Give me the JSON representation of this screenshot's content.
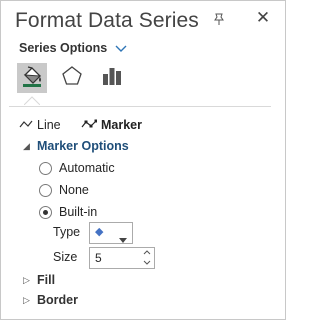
{
  "pane": {
    "title": "Format Data Series",
    "pin_icon": "pin-down-icon",
    "close_glyph": "✕"
  },
  "series_options": {
    "label": "Series Options"
  },
  "icon_tabs": [
    {
      "name": "fill-line-tab",
      "icon": "paint-bucket-icon",
      "selected": true
    },
    {
      "name": "effects-tab",
      "icon": "pentagon-icon",
      "selected": false
    },
    {
      "name": "series-options-tab",
      "icon": "bar-chart-icon",
      "selected": false
    }
  ],
  "subtabs": {
    "line_label": "Line",
    "marker_label": "Marker",
    "active": "Marker"
  },
  "marker_options": {
    "header": "Marker Options",
    "expanded": true,
    "automatic_label": "Automatic",
    "none_label": "None",
    "builtin_label": "Built-in",
    "selected": "Built-in",
    "type_label": "Type",
    "type_value": "◆",
    "size_label": "Size",
    "size_value": "5"
  },
  "fill": {
    "header": "Fill",
    "expanded": false
  },
  "border": {
    "header": "Border",
    "expanded": false
  },
  "colors": {
    "accent": "#1f4e79",
    "marker_fill": "#4472c4",
    "selected_tab_bg": "#c9c9c9",
    "paint_bucket_green": "#217346"
  }
}
